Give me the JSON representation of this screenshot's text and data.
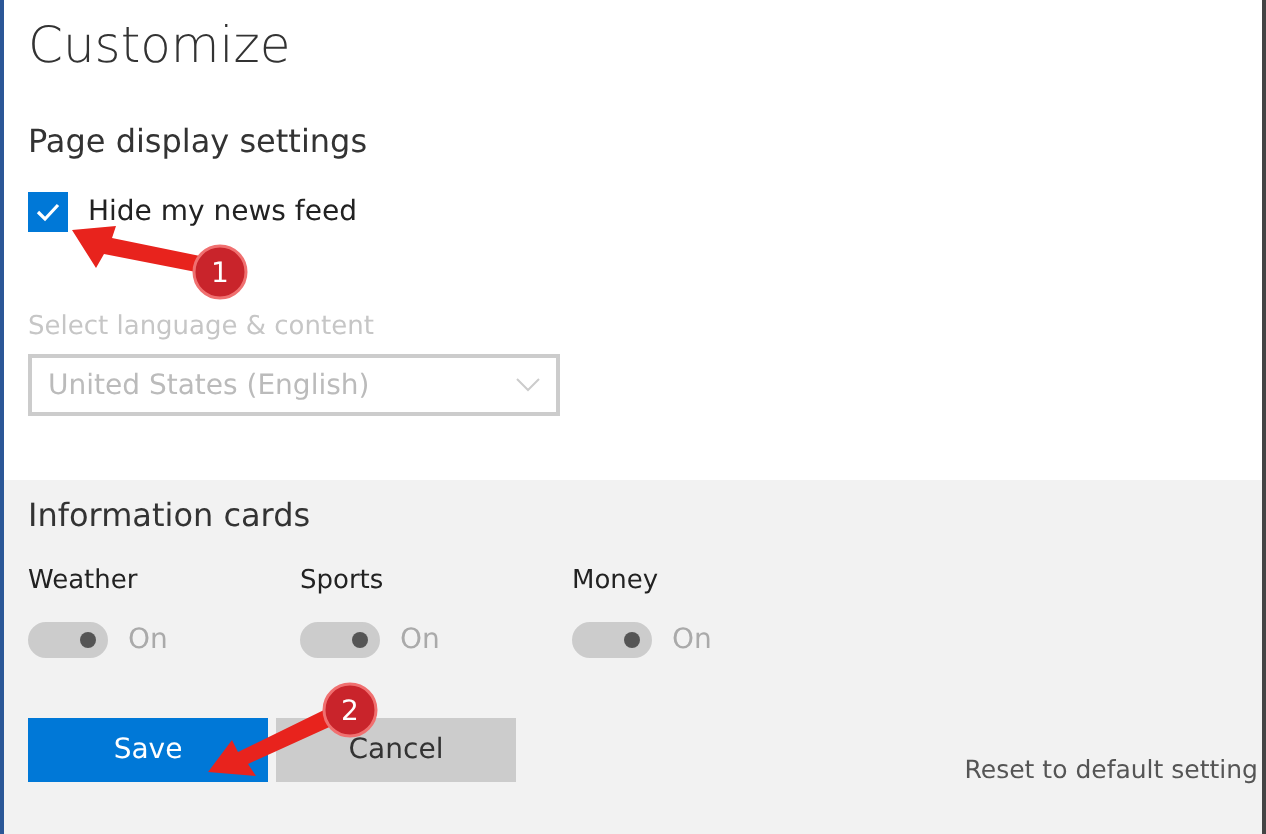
{
  "title": "Customize",
  "page_display": {
    "heading": "Page display settings",
    "checkbox": {
      "label": "Hide my news feed",
      "checked": true
    },
    "language": {
      "label": "Select language & content",
      "value": "United States (English)",
      "disabled": true
    }
  },
  "information_cards": {
    "heading": "Information cards",
    "cards": [
      {
        "label": "Weather",
        "on": true,
        "disabled": true,
        "state_text": "On"
      },
      {
        "label": "Sports",
        "on": true,
        "disabled": true,
        "state_text": "On"
      },
      {
        "label": "Money",
        "on": true,
        "disabled": true,
        "state_text": "On"
      }
    ]
  },
  "buttons": [
    {
      "label": "Save",
      "kind": "primary"
    },
    {
      "label": "Cancel",
      "kind": "secondary"
    }
  ],
  "reset_link": "Reset to default setting",
  "callouts": [
    {
      "number": "1"
    },
    {
      "number": "2"
    }
  ]
}
